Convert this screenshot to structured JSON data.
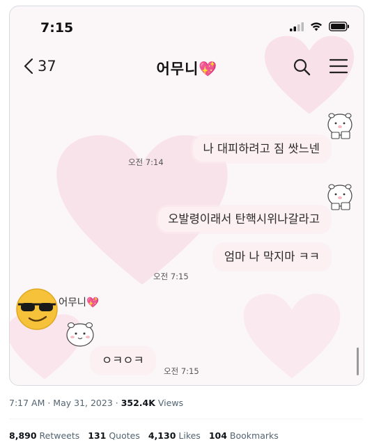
{
  "status_bar": {
    "time": "7:15"
  },
  "nav": {
    "back_count": "37",
    "title": "어무니",
    "title_emoji": "💖"
  },
  "messages": [
    {
      "text": "나 대피하려고 짐 쌋느넨",
      "time": ""
    },
    {
      "time": "오전 7:14"
    },
    {
      "text": "오발령이래서 탄핵시위나갈라고"
    },
    {
      "text": "엄마 나 막지마 ㅋㅋ",
      "time": "오전 7:15"
    },
    {
      "sender": "어무니💖",
      "text": "ㅇㅋㅇㅋ",
      "time": "오전 7:15"
    }
  ],
  "tweet_meta": {
    "timestamp": "7:17 AM · May 31, 2023 · ",
    "views_count": "352.4K",
    "views_label": " Views"
  },
  "stats": {
    "retweets_count": "8,890",
    "retweets_label": "Retweets",
    "quotes_count": "131",
    "quotes_label": "Quotes",
    "likes_count": "4,130",
    "likes_label": "Likes",
    "bookmarks_count": "104",
    "bookmarks_label": "Bookmarks"
  },
  "colors": {
    "bubble": "#fdf0f3",
    "heart": "#f6c9d6",
    "text_secondary": "#536471"
  }
}
